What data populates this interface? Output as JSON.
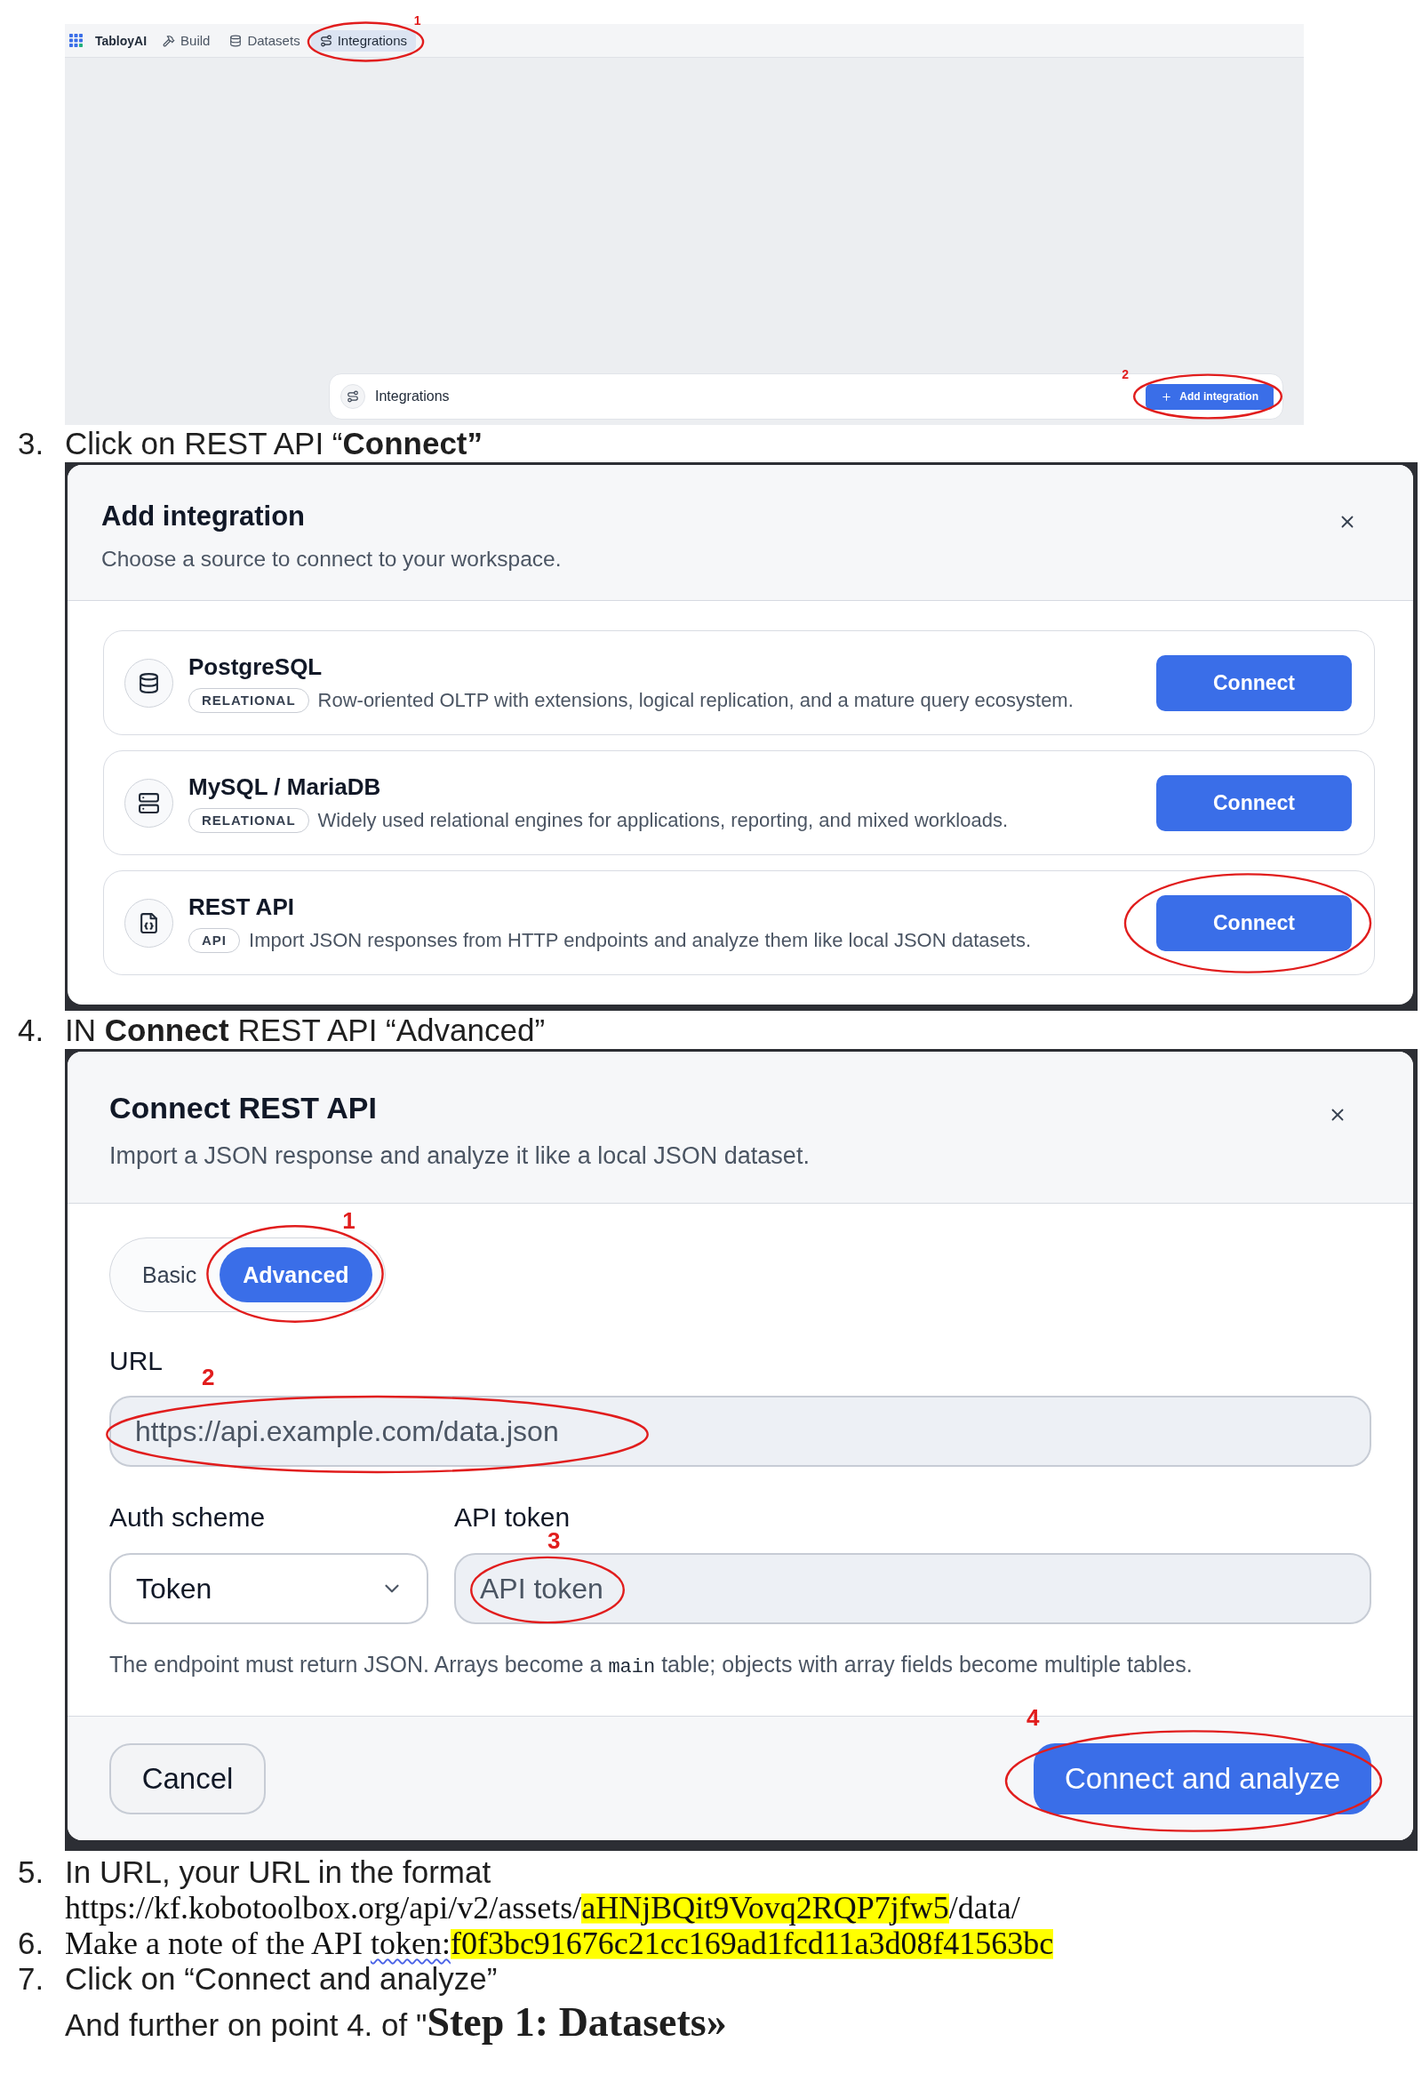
{
  "app_screenshot": {
    "brand": "TabloyAI",
    "nav": [
      {
        "label": "Build",
        "selected": false,
        "circled": false
      },
      {
        "label": "Datasets",
        "selected": false,
        "circled": false
      },
      {
        "label": "Integrations",
        "selected": true,
        "circled": true,
        "callout": "1"
      }
    ],
    "panel": {
      "title": "Integrations",
      "button": {
        "label": "Add integration",
        "circled": true,
        "callout": "2"
      }
    }
  },
  "step_3": {
    "number": "3.",
    "text": "Click on REST API “**Connect”**"
  },
  "add_integration_dialog": {
    "title": "Add integration",
    "subtitle": "Choose a source to connect to your workspace.",
    "sources": [
      {
        "name": "PostgreSQL",
        "tag": "RELATIONAL",
        "description": "Row-oriented OLTP with extensions, logical replication, and a mature query ecosystem.",
        "button": "Connect",
        "circled": false
      },
      {
        "name": "MySQL / MariaDB",
        "tag": "RELATIONAL",
        "description": "Widely used relational engines for applications, reporting, and mixed workloads.",
        "button": "Connect",
        "circled": false
      },
      {
        "name": "REST API",
        "tag": "API",
        "description": "Import JSON responses from HTTP endpoints and analyze them like local JSON datasets.",
        "button": "Connect",
        "circled": true
      }
    ]
  },
  "step_4": {
    "number": "4.",
    "text": "IN **Connect** REST API “Advanced”"
  },
  "connect_rest_dialog": {
    "title": "Connect REST API",
    "subtitle": "Import a JSON response and analyze it like a local JSON dataset.",
    "modes": [
      {
        "label": "Basic",
        "selected": false,
        "circled": false
      },
      {
        "label": "Advanced",
        "selected": true,
        "circled": true,
        "callout": "1"
      }
    ],
    "url_field": {
      "label": "URL",
      "placeholder": "https://api.example.com/data.json",
      "circled": true,
      "callout": "2"
    },
    "auth_field": {
      "label": "Auth scheme",
      "value": "Token"
    },
    "token_field": {
      "label": "API token",
      "placeholder": "API token",
      "circled": true,
      "callout": "3"
    },
    "hint": [
      {
        "kind": "text",
        "text": "The endpoint must return JSON. Arrays become a "
      },
      {
        "kind": "code",
        "text": "main"
      },
      {
        "kind": "text",
        "text": " table; objects with array fields become multiple tables."
      }
    ],
    "cancel_button": "Cancel",
    "submit_button": {
      "label": "Connect and analyze",
      "circled": true,
      "callout": "4"
    }
  },
  "steps": [
    {
      "number": "5.",
      "text": "In URL, your URL in the format",
      "detail": [
        {
          "kind": "plain",
          "text": "https://kf.kobotoolbox.org/api/v2/assets/"
        },
        {
          "kind": "highlight",
          "text": "aHNjBQit9Vovq2RQP7jfw5"
        },
        {
          "kind": "plain",
          "text": "/data/"
        }
      ]
    },
    {
      "number": "6.",
      "detail": [
        {
          "kind": "plain",
          "text": "Make a note of the API "
        },
        {
          "kind": "misspelled",
          "text": "token:"
        },
        {
          "kind": "highlight",
          "text": "f0f3bc91676c21cc169ad1fcd11a3d08f41563bc"
        }
      ]
    },
    {
      "number": "7.",
      "text": "Click on “Connect and analyze”"
    }
  ],
  "closing": [
    {
      "kind": "plain",
      "text": "And further on point 4. of \""
    },
    {
      "kind": "heading",
      "text": "Step 1: Datasets»"
    }
  ]
}
